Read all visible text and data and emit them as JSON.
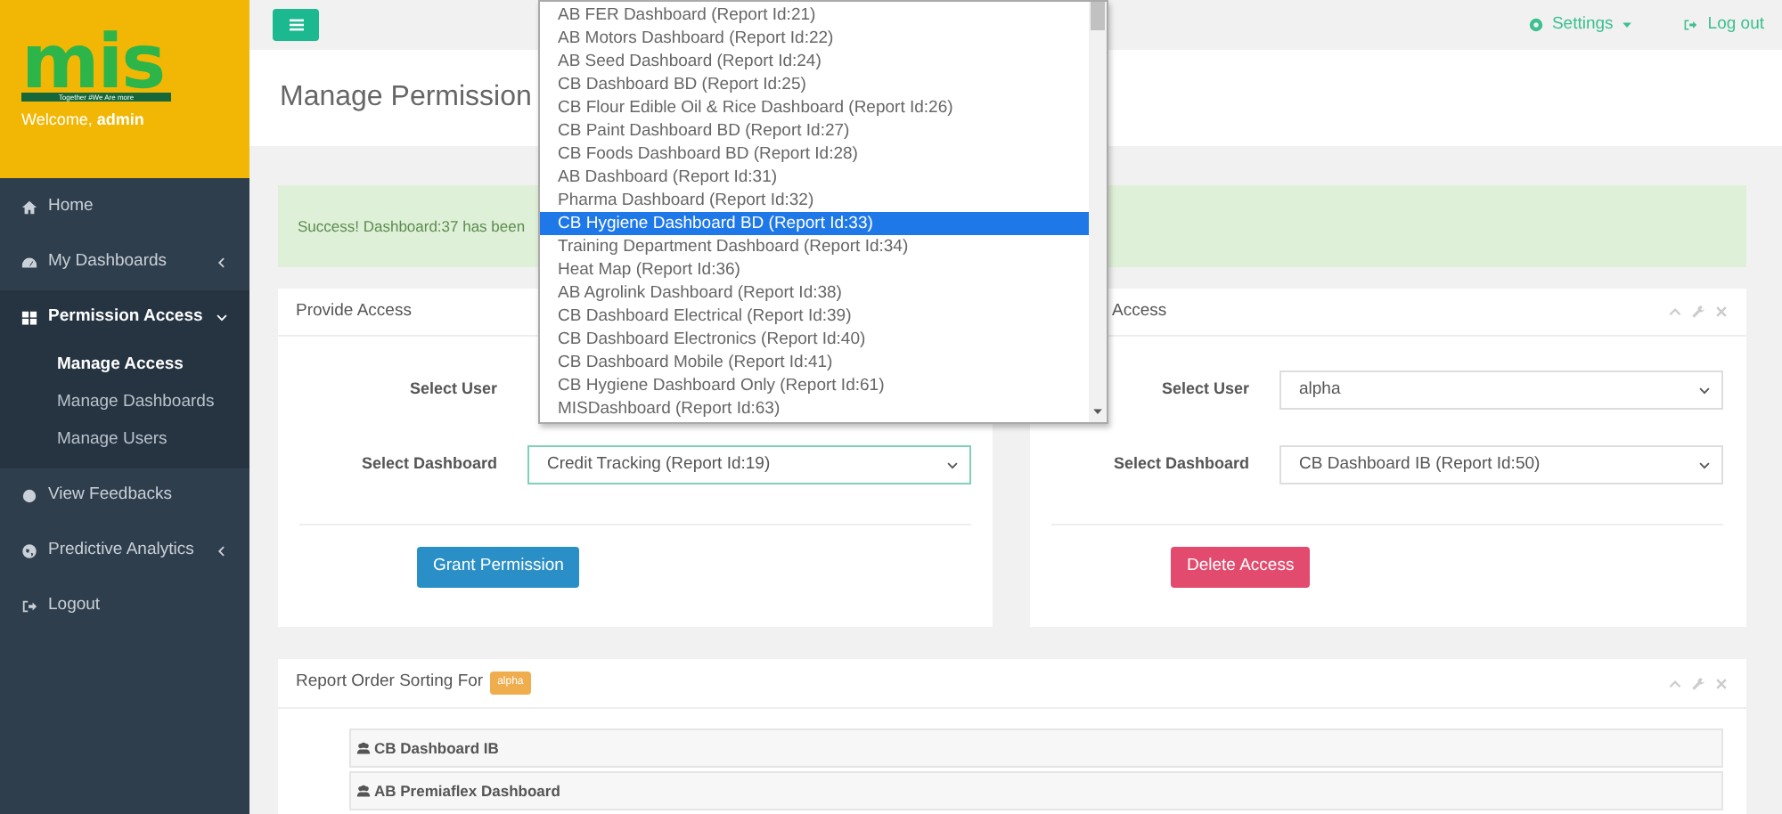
{
  "brand": {
    "logo": "mis",
    "tagline": "Together #We Are more",
    "welcome": "Welcome, **admin**"
  },
  "sidebar": {
    "items": [
      {
        "label": "Home",
        "expanded": false,
        "has_submenu": false
      },
      {
        "label": "My Dashboards",
        "expanded": false,
        "has_submenu": true
      },
      {
        "label": "Permission Access",
        "expanded": true,
        "has_submenu": true,
        "children": [
          {
            "label": "Manage Access",
            "selected": true
          },
          {
            "label": "Manage Dashboards",
            "selected": false
          },
          {
            "label": "Manage Users",
            "selected": false
          }
        ]
      },
      {
        "label": "View Feedbacks",
        "expanded": false,
        "has_submenu": false
      },
      {
        "label": "Predictive Analytics",
        "expanded": false,
        "has_submenu": true
      },
      {
        "label": "Logout",
        "expanded": false,
        "has_submenu": false
      }
    ]
  },
  "topbar": {
    "settings": "Settings",
    "logout": "Log out"
  },
  "page_title": "Manage Permission",
  "alert": "Success! Dashboard:37 has been",
  "provide_access": {
    "title": "Provide Access",
    "user_label": "Select User",
    "dashboard_label": "Select Dashboard",
    "dashboard_value": "Credit Tracking (Report Id:19)",
    "button": "Grant Permission"
  },
  "remove_access": {
    "title": "Access",
    "user_label": "Select User",
    "user_value": "alpha",
    "dashboard_label": "Select Dashboard",
    "dashboard_value": "CB Dashboard IB (Report Id:50)",
    "button": "Delete Access"
  },
  "sorting": {
    "title": "Report Order Sorting For",
    "user_badge": "alpha",
    "items": [
      "CB Dashboard IB",
      "AB Premiaflex Dashboard"
    ]
  },
  "dropdown": {
    "options": [
      {
        "label": "AB FER Dashboard (Report Id:21)",
        "selected": false
      },
      {
        "label": "AB Motors Dashboard (Report Id:22)",
        "selected": false
      },
      {
        "label": "AB Seed Dashboard (Report Id:24)",
        "selected": false
      },
      {
        "label": "CB Dashboard BD (Report Id:25)",
        "selected": false
      },
      {
        "label": "CB Flour Edible Oil & Rice Dashboard (Report Id:26)",
        "selected": false
      },
      {
        "label": "CB Paint Dashboard BD (Report Id:27)",
        "selected": false
      },
      {
        "label": "CB Foods Dashboard BD (Report Id:28)",
        "selected": false
      },
      {
        "label": "AB Dashboard (Report Id:31)",
        "selected": false
      },
      {
        "label": "Pharma Dashboard (Report Id:32)",
        "selected": false
      },
      {
        "label": "CB Hygiene Dashboard BD (Report Id:33)",
        "selected": true
      },
      {
        "label": "Training Department Dashboard (Report Id:34)",
        "selected": false
      },
      {
        "label": "Heat Map (Report Id:36)",
        "selected": false
      },
      {
        "label": "AB Agrolink Dashboard (Report Id:38)",
        "selected": false
      },
      {
        "label": "CB Dashboard Electrical (Report Id:39)",
        "selected": false
      },
      {
        "label": "CB Dashboard Electronics (Report Id:40)",
        "selected": false
      },
      {
        "label": "CB Dashboard Mobile (Report Id:41)",
        "selected": false
      },
      {
        "label": "CB Hygiene Dashboard Only (Report Id:61)",
        "selected": false
      },
      {
        "label": "MISDashboard (Report Id:63)",
        "selected": false
      }
    ]
  }
}
